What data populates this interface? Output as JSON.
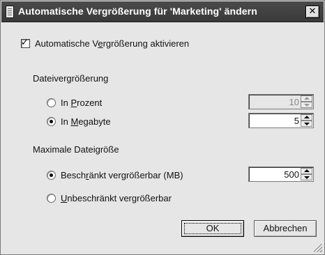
{
  "window": {
    "title": "Automatische Vergrößerung für 'Marketing' ändern",
    "close_icon": "close-icon"
  },
  "autogrowth": {
    "enable_label_pre": "Automatische V",
    "enable_label_accel": "e",
    "enable_label_post": "rgrößerung aktivieren",
    "enabled": true
  },
  "file_growth": {
    "heading": "Dateivergrößerung",
    "percent": {
      "label_pre": "In ",
      "label_accel": "P",
      "label_post": "rozent",
      "selected": false,
      "value": "10",
      "disabled": true
    },
    "megabyte": {
      "label_pre": "In ",
      "label_accel": "M",
      "label_post": "egabyte",
      "selected": true,
      "value": "5"
    }
  },
  "max_size": {
    "heading": "Maximale Dateigröße",
    "restricted": {
      "label_pre": "Besch",
      "label_accel": "r",
      "label_post": "änkt vergrößerbar (MB)",
      "selected": true,
      "value": "500"
    },
    "unrestricted": {
      "label_pre": "",
      "label_accel": "U",
      "label_post": "nbeschränkt vergrößerbar",
      "selected": false
    }
  },
  "buttons": {
    "ok": "OK",
    "cancel": "Abbrechen"
  }
}
